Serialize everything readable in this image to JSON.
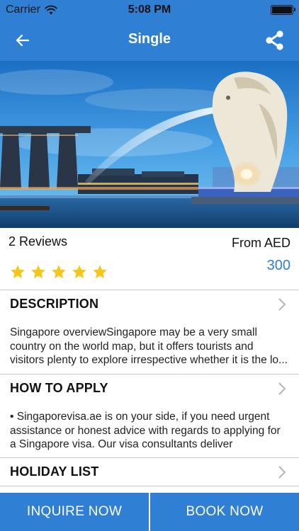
{
  "status_bar": {
    "carrier": "Carrier",
    "time": "5:08 PM",
    "icons": [
      "wifi-icon",
      "battery-icon"
    ]
  },
  "nav": {
    "title": "Single",
    "back_icon": "arrow-left-icon",
    "share_icon": "share-icon"
  },
  "hero": {
    "image": "singapore-merlion-marina-bay-photo"
  },
  "reviews": {
    "count_label": "2 Reviews",
    "rating": 5,
    "rating_max": 5
  },
  "price": {
    "label": "From AED",
    "value": "300"
  },
  "sections": [
    {
      "title": "DESCRIPTION",
      "lines": [
        "Singapore overviewSingapore may be a very small",
        "country on the world map, but it offers tourists and",
        "visitors plenty to explore irrespective whether it is the lo..."
      ]
    },
    {
      "title": "HOW TO APPLY",
      "lines": [
        "• Singaporevisa.ae is on your side, if you need urgent",
        "assistance or honest advice with regards to applying for",
        "a Singapore visa. Our visa consultants deliver"
      ]
    },
    {
      "title": "HOLIDAY LIST",
      "lines": []
    }
  ],
  "buttons": {
    "inquire": "INQUIRE NOW",
    "book": "BOOK NOW"
  },
  "colors": {
    "brand": "#2f7fd4",
    "star": "#f5c518",
    "divider": "#c8c8c8"
  }
}
